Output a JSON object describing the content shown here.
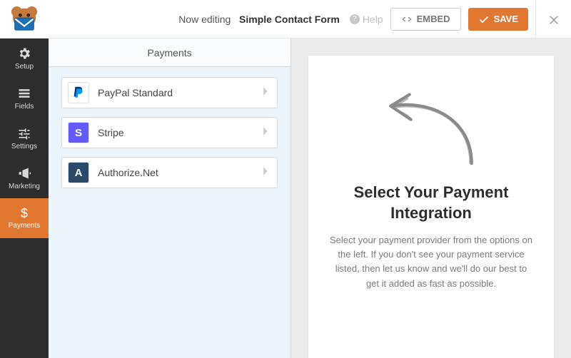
{
  "header": {
    "editing_prefix": "Now editing",
    "form_name": "Simple Contact Form",
    "help_label": "Help",
    "embed_label": "EMBED",
    "save_label": "SAVE"
  },
  "sidebar": {
    "items": [
      {
        "id": "setup",
        "label": "Setup"
      },
      {
        "id": "fields",
        "label": "Fields"
      },
      {
        "id": "settings",
        "label": "Settings"
      },
      {
        "id": "marketing",
        "label": "Marketing"
      },
      {
        "id": "payments",
        "label": "Payments"
      }
    ],
    "active": "payments"
  },
  "panel": {
    "title": "Payments",
    "providers": [
      {
        "id": "paypal",
        "label": "PayPal Standard"
      },
      {
        "id": "stripe",
        "label": "Stripe"
      },
      {
        "id": "authorize",
        "label": "Authorize.Net"
      }
    ]
  },
  "hero": {
    "title": "Select Your Payment Integration",
    "body": "Select your payment provider from the options on the left. If you don't see your payment service listed, then let us know and we'll do our best to get it added as fast as possible."
  }
}
